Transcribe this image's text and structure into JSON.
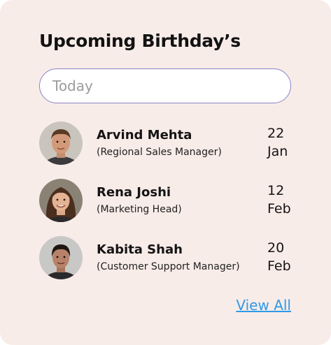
{
  "widget": {
    "title": "Upcoming Birthday’s",
    "filter": {
      "selected": "Today"
    },
    "people": [
      {
        "name": "Arvind Mehta",
        "role": "(Regional Sales Manager)",
        "day": "22",
        "month": "Jan",
        "avatar_icon": "person-photo-icon"
      },
      {
        "name": "Rena Joshi",
        "role": "(Marketing Head)",
        "day": "12",
        "month": "Feb",
        "avatar_icon": "person-photo-icon"
      },
      {
        "name": "Kabita Shah",
        "role": "(Customer Support Manager)",
        "day": "20",
        "month": "Feb",
        "avatar_icon": "person-photo-icon"
      }
    ],
    "view_all_label": "View All"
  },
  "colors": {
    "card_background": "#f8ece8",
    "filter_border": "#8c82c6",
    "link": "#2f9ae8"
  }
}
